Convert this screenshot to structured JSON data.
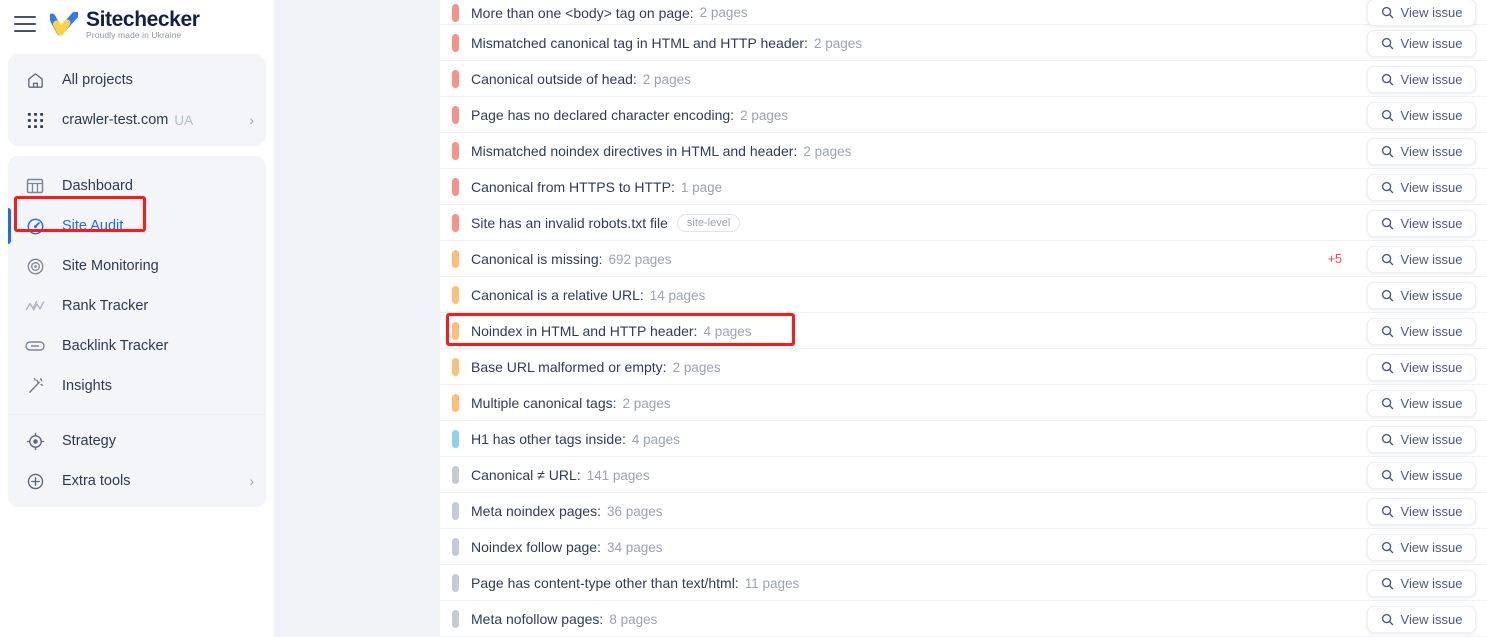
{
  "sidebar": {
    "menu_icon": "hamburger-menu-icon",
    "logo": {
      "name": "Sitechecker",
      "tagline": "Proudly made in Ukraine",
      "icon": "checkmark-logo-icon"
    },
    "projects": [
      {
        "label": "All projects",
        "icon": "home-icon",
        "sub": "",
        "chevron": ""
      },
      {
        "label": "crawler-test.com",
        "icon": "grid-dots-icon",
        "sub": "UA",
        "chevron": "›"
      }
    ],
    "nav": [
      {
        "label": "Dashboard",
        "icon": "dashboard-icon",
        "active": false
      },
      {
        "label": "Site Audit",
        "icon": "site-audit-gauge-icon",
        "active": true
      },
      {
        "label": "Site Monitoring",
        "icon": "site-monitoring-icon",
        "active": false
      },
      {
        "label": "Rank Tracker",
        "icon": "rank-tracker-chart-icon",
        "active": false
      },
      {
        "label": "Backlink Tracker",
        "icon": "link-icon",
        "active": false
      },
      {
        "label": "Insights",
        "icon": "magic-wand-icon",
        "active": false
      }
    ],
    "tools": [
      {
        "label": "Strategy",
        "icon": "target-icon",
        "chevron": ""
      },
      {
        "label": "Extra tools",
        "icon": "plus-circle-icon",
        "chevron": "›"
      }
    ]
  },
  "colors": {
    "severity_critical": "#f79289",
    "severity_warning": "#fbc077",
    "severity_notice": "#8bd3f2",
    "severity_info": "#c4cbd6",
    "accent_blue": "#1c6bf2",
    "alert_red": "#f0453a",
    "highlight_red": "#ff1a1a"
  },
  "main": {
    "view_issue_label": "View issue",
    "search_icon": "magnifier-icon",
    "issues": [
      {
        "name": "More than one <body> tag on page:",
        "count": "2 pages",
        "severity": "critical",
        "badge": "",
        "more": "",
        "highlighted": false
      },
      {
        "name": "Mismatched canonical tag in HTML and HTTP header:",
        "count": "2 pages",
        "severity": "critical",
        "badge": "",
        "more": "",
        "highlighted": false
      },
      {
        "name": "Canonical outside of head:",
        "count": "2 pages",
        "severity": "critical",
        "badge": "",
        "more": "",
        "highlighted": false
      },
      {
        "name": "Page has no declared character encoding:",
        "count": "2 pages",
        "severity": "critical",
        "badge": "",
        "more": "",
        "highlighted": false
      },
      {
        "name": "Mismatched noindex directives in HTML and header:",
        "count": "2 pages",
        "severity": "critical",
        "badge": "",
        "more": "",
        "highlighted": false
      },
      {
        "name": "Canonical from HTTPS to HTTP:",
        "count": "1 page",
        "severity": "critical",
        "badge": "",
        "more": "",
        "highlighted": false
      },
      {
        "name": "Site has an invalid robots.txt file",
        "count": "",
        "severity": "critical",
        "badge": "site-level",
        "more": "",
        "highlighted": false
      },
      {
        "name": "Canonical is missing:",
        "count": "692 pages",
        "severity": "warning",
        "badge": "",
        "more": "+5",
        "highlighted": false
      },
      {
        "name": "Canonical is a relative URL:",
        "count": "14 pages",
        "severity": "warning",
        "badge": "",
        "more": "",
        "highlighted": false
      },
      {
        "name": "Noindex in HTML and HTTP header:",
        "count": "4 pages",
        "severity": "warning",
        "badge": "",
        "more": "",
        "highlighted": true
      },
      {
        "name": "Base URL malformed or empty:",
        "count": "2 pages",
        "severity": "warning",
        "badge": "",
        "more": "",
        "highlighted": false
      },
      {
        "name": "Multiple canonical tags:",
        "count": "2 pages",
        "severity": "warning",
        "badge": "",
        "more": "",
        "highlighted": false
      },
      {
        "name": "H1 has other tags inside:",
        "count": "4 pages",
        "severity": "notice",
        "badge": "",
        "more": "",
        "highlighted": false
      },
      {
        "name": "Canonical ≠ URL:",
        "count": "141 pages",
        "severity": "info",
        "badge": "",
        "more": "",
        "highlighted": false
      },
      {
        "name": "Meta noindex pages:",
        "count": "36 pages",
        "severity": "info",
        "badge": "",
        "more": "",
        "highlighted": false
      },
      {
        "name": "Noindex follow page:",
        "count": "34 pages",
        "severity": "info",
        "badge": "",
        "more": "",
        "highlighted": false
      },
      {
        "name": "Page has content-type other than text/html:",
        "count": "11 pages",
        "severity": "info",
        "badge": "",
        "more": "",
        "highlighted": false
      },
      {
        "name": "Meta nofollow pages:",
        "count": "8 pages",
        "severity": "info",
        "badge": "",
        "more": "",
        "highlighted": false
      }
    ]
  }
}
